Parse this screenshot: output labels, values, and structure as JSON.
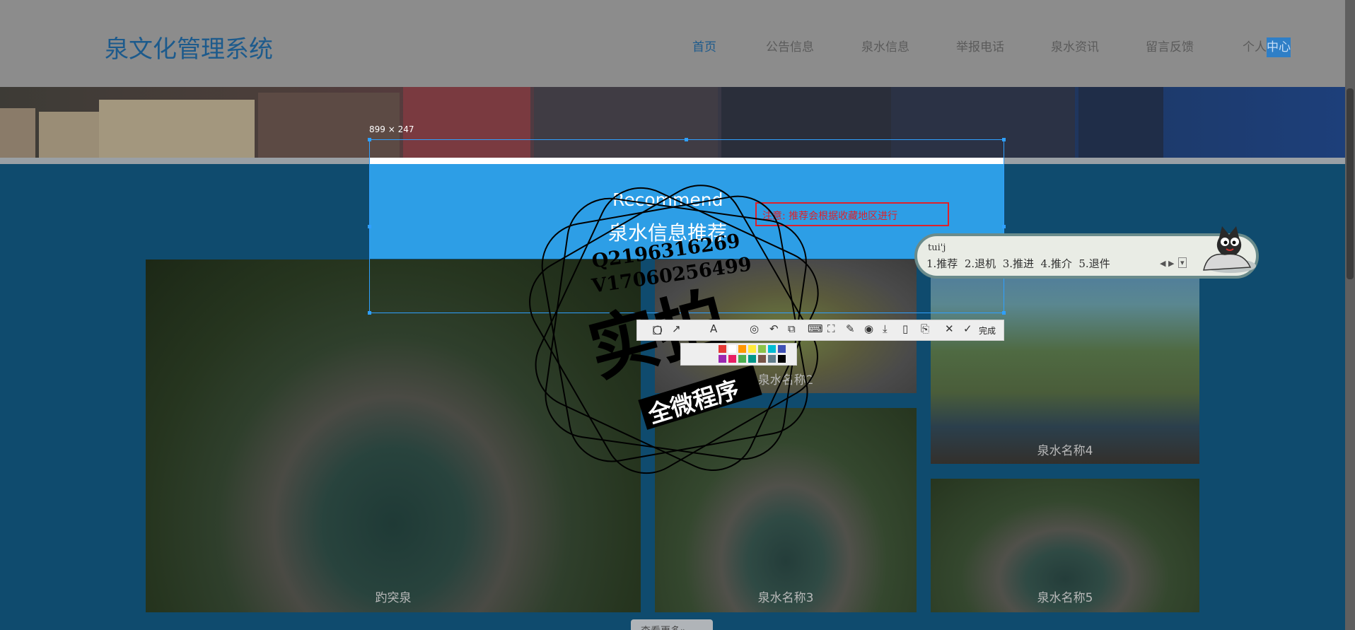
{
  "header": {
    "site_title": "泉文化管理系统",
    "nav": [
      {
        "label": "首页",
        "active": true
      },
      {
        "label": "公告信息"
      },
      {
        "label": "泉水信息"
      },
      {
        "label": "举报电话"
      },
      {
        "label": "泉水资讯"
      },
      {
        "label": "留言反馈"
      }
    ],
    "personal_a": "个人",
    "personal_b": "中心"
  },
  "section": {
    "title_en": "Recommend",
    "title_cn": "泉水信息推荐",
    "notice": "注意: 推荐会根据收藏地区进行"
  },
  "cards": [
    {
      "label": "趵突泉"
    },
    {
      "label": "泉水名称2"
    },
    {
      "label": "泉水名称3"
    },
    {
      "label": "泉水名称4"
    },
    {
      "label": "泉水名称5"
    }
  ],
  "more_button": "查看更多»",
  "screenshot_tool": {
    "size_label": "899 × 247",
    "done_label": "完成",
    "swatch_colors": [
      "#e53935",
      "#ffffff",
      "#ff9800",
      "#ffeb3b",
      "#8bc34a",
      "#00bcd4",
      "#3f51b5",
      "#9c27b0",
      "#e91e63",
      "#4caf50",
      "#009688",
      "#795548",
      "#607d8b",
      "#000000"
    ]
  },
  "ime": {
    "input": "tui'j",
    "candidates": "1.推荐  2.退机  3.推进  4.推介  5.退件"
  },
  "watermark": {
    "qq": "Q2196316269",
    "v": "V17060256499",
    "big": "实拍",
    "sub": "全微程序"
  }
}
